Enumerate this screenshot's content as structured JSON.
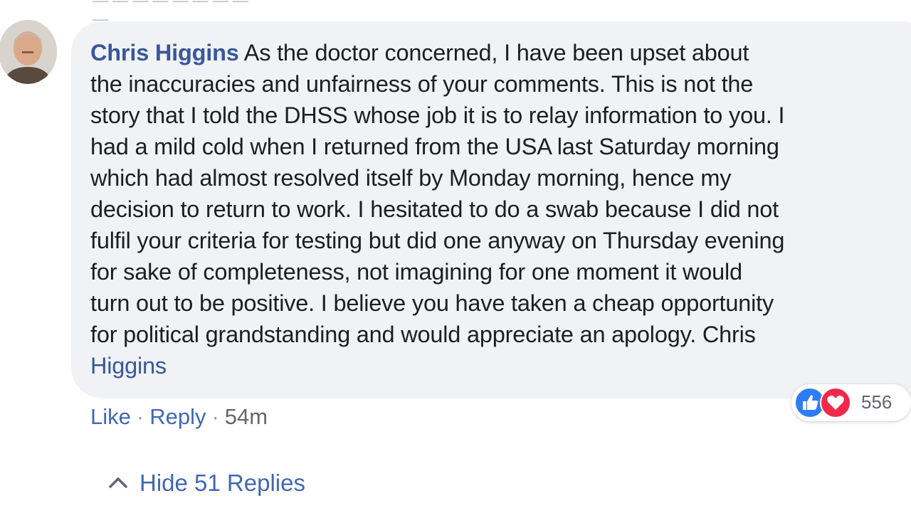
{
  "top_fragment": "— — — — — — — — —",
  "comment": {
    "author": "Chris Higgins",
    "lines": [
      "As the doctor concerned, I have been upset about",
      "the inaccuracies and unfairness of your comments. This is not the",
      "story that I told the DHSS whose job it is to relay information to you. I",
      "had a mild cold when I returned from the USA last Saturday morning",
      "which had almost resolved itself by Monday morning, hence my",
      "decision to return to work. I hesitated to do a swab because I did not",
      "fulfil your criteria for testing but did one anyway on Thursday evening",
      "for sake of completeness, not imagining for one moment it would",
      "turn out to be positive. I believe you have taken a cheap opportunity",
      "for political grandstanding and would appreciate an apology. Chris"
    ],
    "signature_link": "Higgins"
  },
  "reactions": {
    "icons": [
      "like-icon",
      "love-icon"
    ],
    "count": "556",
    "like_color": "#2e7bf6",
    "love_color": "#f0284a"
  },
  "actions": {
    "like": "Like",
    "reply": "Reply",
    "separator": "·",
    "time": "54m"
  },
  "replies": {
    "toggle_label": "Hide 51 Replies",
    "icon": "chevron-up-icon"
  },
  "colors": {
    "link": "#385898",
    "bubble": "#f0f2f5",
    "meta": "#606770"
  }
}
